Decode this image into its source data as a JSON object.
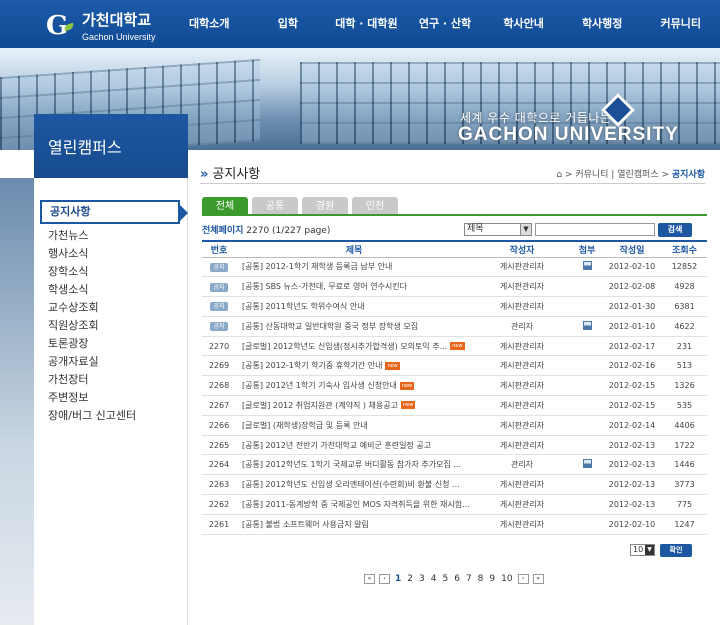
{
  "header": {
    "logo_kr": "가천대학교",
    "logo_en": "Gachon University",
    "nav": [
      "대학소개",
      "입학",
      "대학 · 대학원",
      "연구 · 산학",
      "학사안내",
      "학사행정",
      "커뮤니티"
    ]
  },
  "banner": {
    "slogan": "세계 우수 대학으로 거듭나는",
    "name": "GACHON UNIVERSITY"
  },
  "sidebar": {
    "title": "열린캠퍼스",
    "items": [
      "공지사항",
      "가천뉴스",
      "행사소식",
      "장학소식",
      "학생소식",
      "교수상조회",
      "직원상조회",
      "토론광장",
      "공개자료실",
      "가천장터",
      "주변정보",
      "장애/버그 신고센터"
    ]
  },
  "page": {
    "title": "공지사항",
    "breadcrumb": [
      "커뮤니티",
      "열린캠퍼스",
      "공지사항"
    ]
  },
  "tabs": [
    "전체",
    "공통",
    "경원",
    "인천"
  ],
  "summary": {
    "label": "전체페이지",
    "count_text": "2270 (1/227 page)"
  },
  "search": {
    "field": "제목",
    "button": "검색"
  },
  "table": {
    "headers": [
      "번호",
      "제목",
      "작성자",
      "첨부",
      "작성일",
      "조회수"
    ],
    "notice_label": "공지",
    "new_label": "new",
    "rows": [
      {
        "no": "",
        "notice": true,
        "title": "[공통] 2012-1학기 재학생 등록금 납부 안내",
        "author": "게시판관리자",
        "attach": true,
        "date": "2012-02-10",
        "views": "12852",
        "new": false
      },
      {
        "no": "",
        "notice": true,
        "title": "[공통] SBS 뉴스-가천대, 무료로 영어 연수시킨다",
        "author": "게시판관리자",
        "attach": false,
        "date": "2012-02-08",
        "views": "4928",
        "new": false
      },
      {
        "no": "",
        "notice": true,
        "title": "[공통] 2011학년도 학위수여식 안내",
        "author": "게시판관리자",
        "attach": false,
        "date": "2012-01-30",
        "views": "6381",
        "new": false
      },
      {
        "no": "",
        "notice": true,
        "title": "[공통] 산동대학교 일반대학원 중국 정부 장학생 모집",
        "author": "관리자",
        "attach": true,
        "date": "2012-01-10",
        "views": "4622",
        "new": false
      },
      {
        "no": "2270",
        "notice": false,
        "title": "[글로벌] 2012학년도 신입생(정시추가합격생) 모의토익 추...",
        "author": "게시판관리자",
        "attach": false,
        "date": "2012-02-17",
        "views": "231",
        "new": true
      },
      {
        "no": "2269",
        "notice": false,
        "title": "[공통] 2012-1학기 학기중 휴학기간 안내",
        "author": "게시판관리자",
        "attach": false,
        "date": "2012-02-16",
        "views": "513",
        "new": true
      },
      {
        "no": "2268",
        "notice": false,
        "title": "[공통] 2012년 1학기 기숙사 입사생 신청안내",
        "author": "게시판관리자",
        "attach": false,
        "date": "2012-02-15",
        "views": "1326",
        "new": true
      },
      {
        "no": "2267",
        "notice": false,
        "title": "[글로벌] 2012 취업지원관 (계약직 ) 채용공고",
        "author": "게시판관리자",
        "attach": false,
        "date": "2012-02-15",
        "views": "535",
        "new": true
      },
      {
        "no": "2266",
        "notice": false,
        "title": "[글로벌] (재학생)장학금 및 등록 안내",
        "author": "게시판관리자",
        "attach": false,
        "date": "2012-02-14",
        "views": "4406",
        "new": false
      },
      {
        "no": "2265",
        "notice": false,
        "title": "[공통] 2012년 전반기 가천대학교 예비군 훈련일정 공고",
        "author": "게시판관리자",
        "attach": false,
        "date": "2012-02-13",
        "views": "1722",
        "new": false
      },
      {
        "no": "2264",
        "notice": false,
        "title": "[공통] 2012학년도 1학기 국제교류 버디활동 참가자 추가모집 ...",
        "author": "관리자",
        "attach": true,
        "date": "2012-02-13",
        "views": "1446",
        "new": false
      },
      {
        "no": "2263",
        "notice": false,
        "title": "[공통] 2012학년도 신입생 오리엔테이션(수련회)비 환불 신청 ...",
        "author": "게시판관리자",
        "attach": false,
        "date": "2012-02-13",
        "views": "3773",
        "new": false
      },
      {
        "no": "2262",
        "notice": false,
        "title": "[공통] 2011-동계방학 중 국제공인 MOS 자격취득을 위한 재시험...",
        "author": "게시판관리자",
        "attach": false,
        "date": "2012-02-13",
        "views": "775",
        "new": false
      },
      {
        "no": "2261",
        "notice": false,
        "title": "[공통] 불법 소프트웨어 사용금지 알림",
        "author": "게시판관리자",
        "attach": false,
        "date": "2012-02-10",
        "views": "1247",
        "new": false
      }
    ]
  },
  "per_page": "10",
  "confirm_button": "확인",
  "pagination": {
    "first": "«",
    "prev": "‹",
    "pages": [
      "1",
      "2",
      "3",
      "4",
      "5",
      "6",
      "7",
      "8",
      "9",
      "10"
    ],
    "current": "1",
    "next": "›",
    "last": "»"
  },
  "colors": {
    "brand_blue": "#1d57a1",
    "tab_green": "#3b9a2c",
    "new_badge": "#e8661a"
  }
}
